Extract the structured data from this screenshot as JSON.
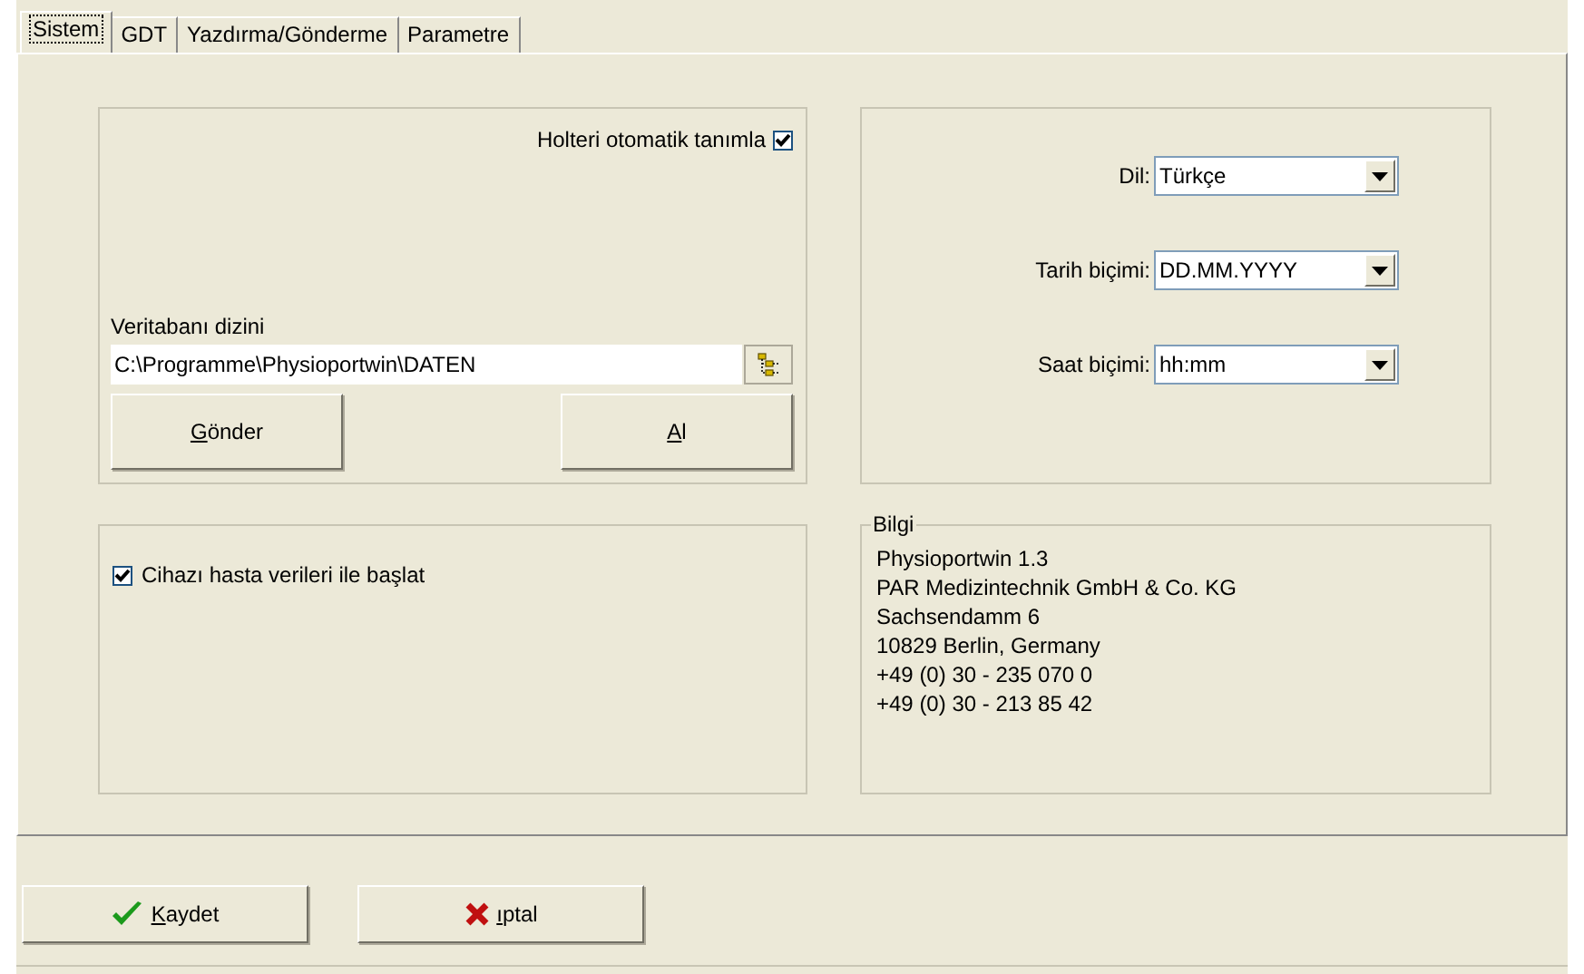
{
  "tabs": [
    {
      "label": "Sistem",
      "selected": true
    },
    {
      "label": "GDT",
      "selected": false
    },
    {
      "label": "Yazdırma/Gönderme",
      "selected": false
    },
    {
      "label": "Parametre",
      "selected": false
    }
  ],
  "database_group": {
    "auto_detect": {
      "label": "Holteri otomatik tanımla",
      "checked": true
    },
    "path_label": "Veritabanı dizini",
    "path_value": "C:\\Programme\\Physioportwin\\DATEN",
    "buttons": [
      {
        "label": "Gönder",
        "underline_first": true
      },
      {
        "label": "Al",
        "underline_first": true
      }
    ]
  },
  "format_group": {
    "fields": [
      {
        "label": "Dil:",
        "value": "Türkçe"
      },
      {
        "label": "Tarih biçimi:",
        "value": "DD.MM.YYYY"
      },
      {
        "label": "Saat biçimi:",
        "value": "hh:mm"
      }
    ]
  },
  "start_group": {
    "start_with_patient": {
      "label": "Cihazı hasta verileri ile başlat",
      "checked": true
    }
  },
  "info_group": {
    "title": "Bilgi",
    "lines": [
      "Physioportwin 1.3",
      "PAR Medizintechnik GmbH & Co. KG",
      "Sachsendamm 6",
      "10829 Berlin, Germany",
      "+49 (0) 30 - 235 070 0",
      "+49 (0) 30 - 213 85 42"
    ]
  },
  "footer_buttons": [
    {
      "kind": "save",
      "label": "Kaydet",
      "underline_first": true
    },
    {
      "kind": "cancel",
      "label": "ıptal",
      "underline_first": true
    }
  ]
}
